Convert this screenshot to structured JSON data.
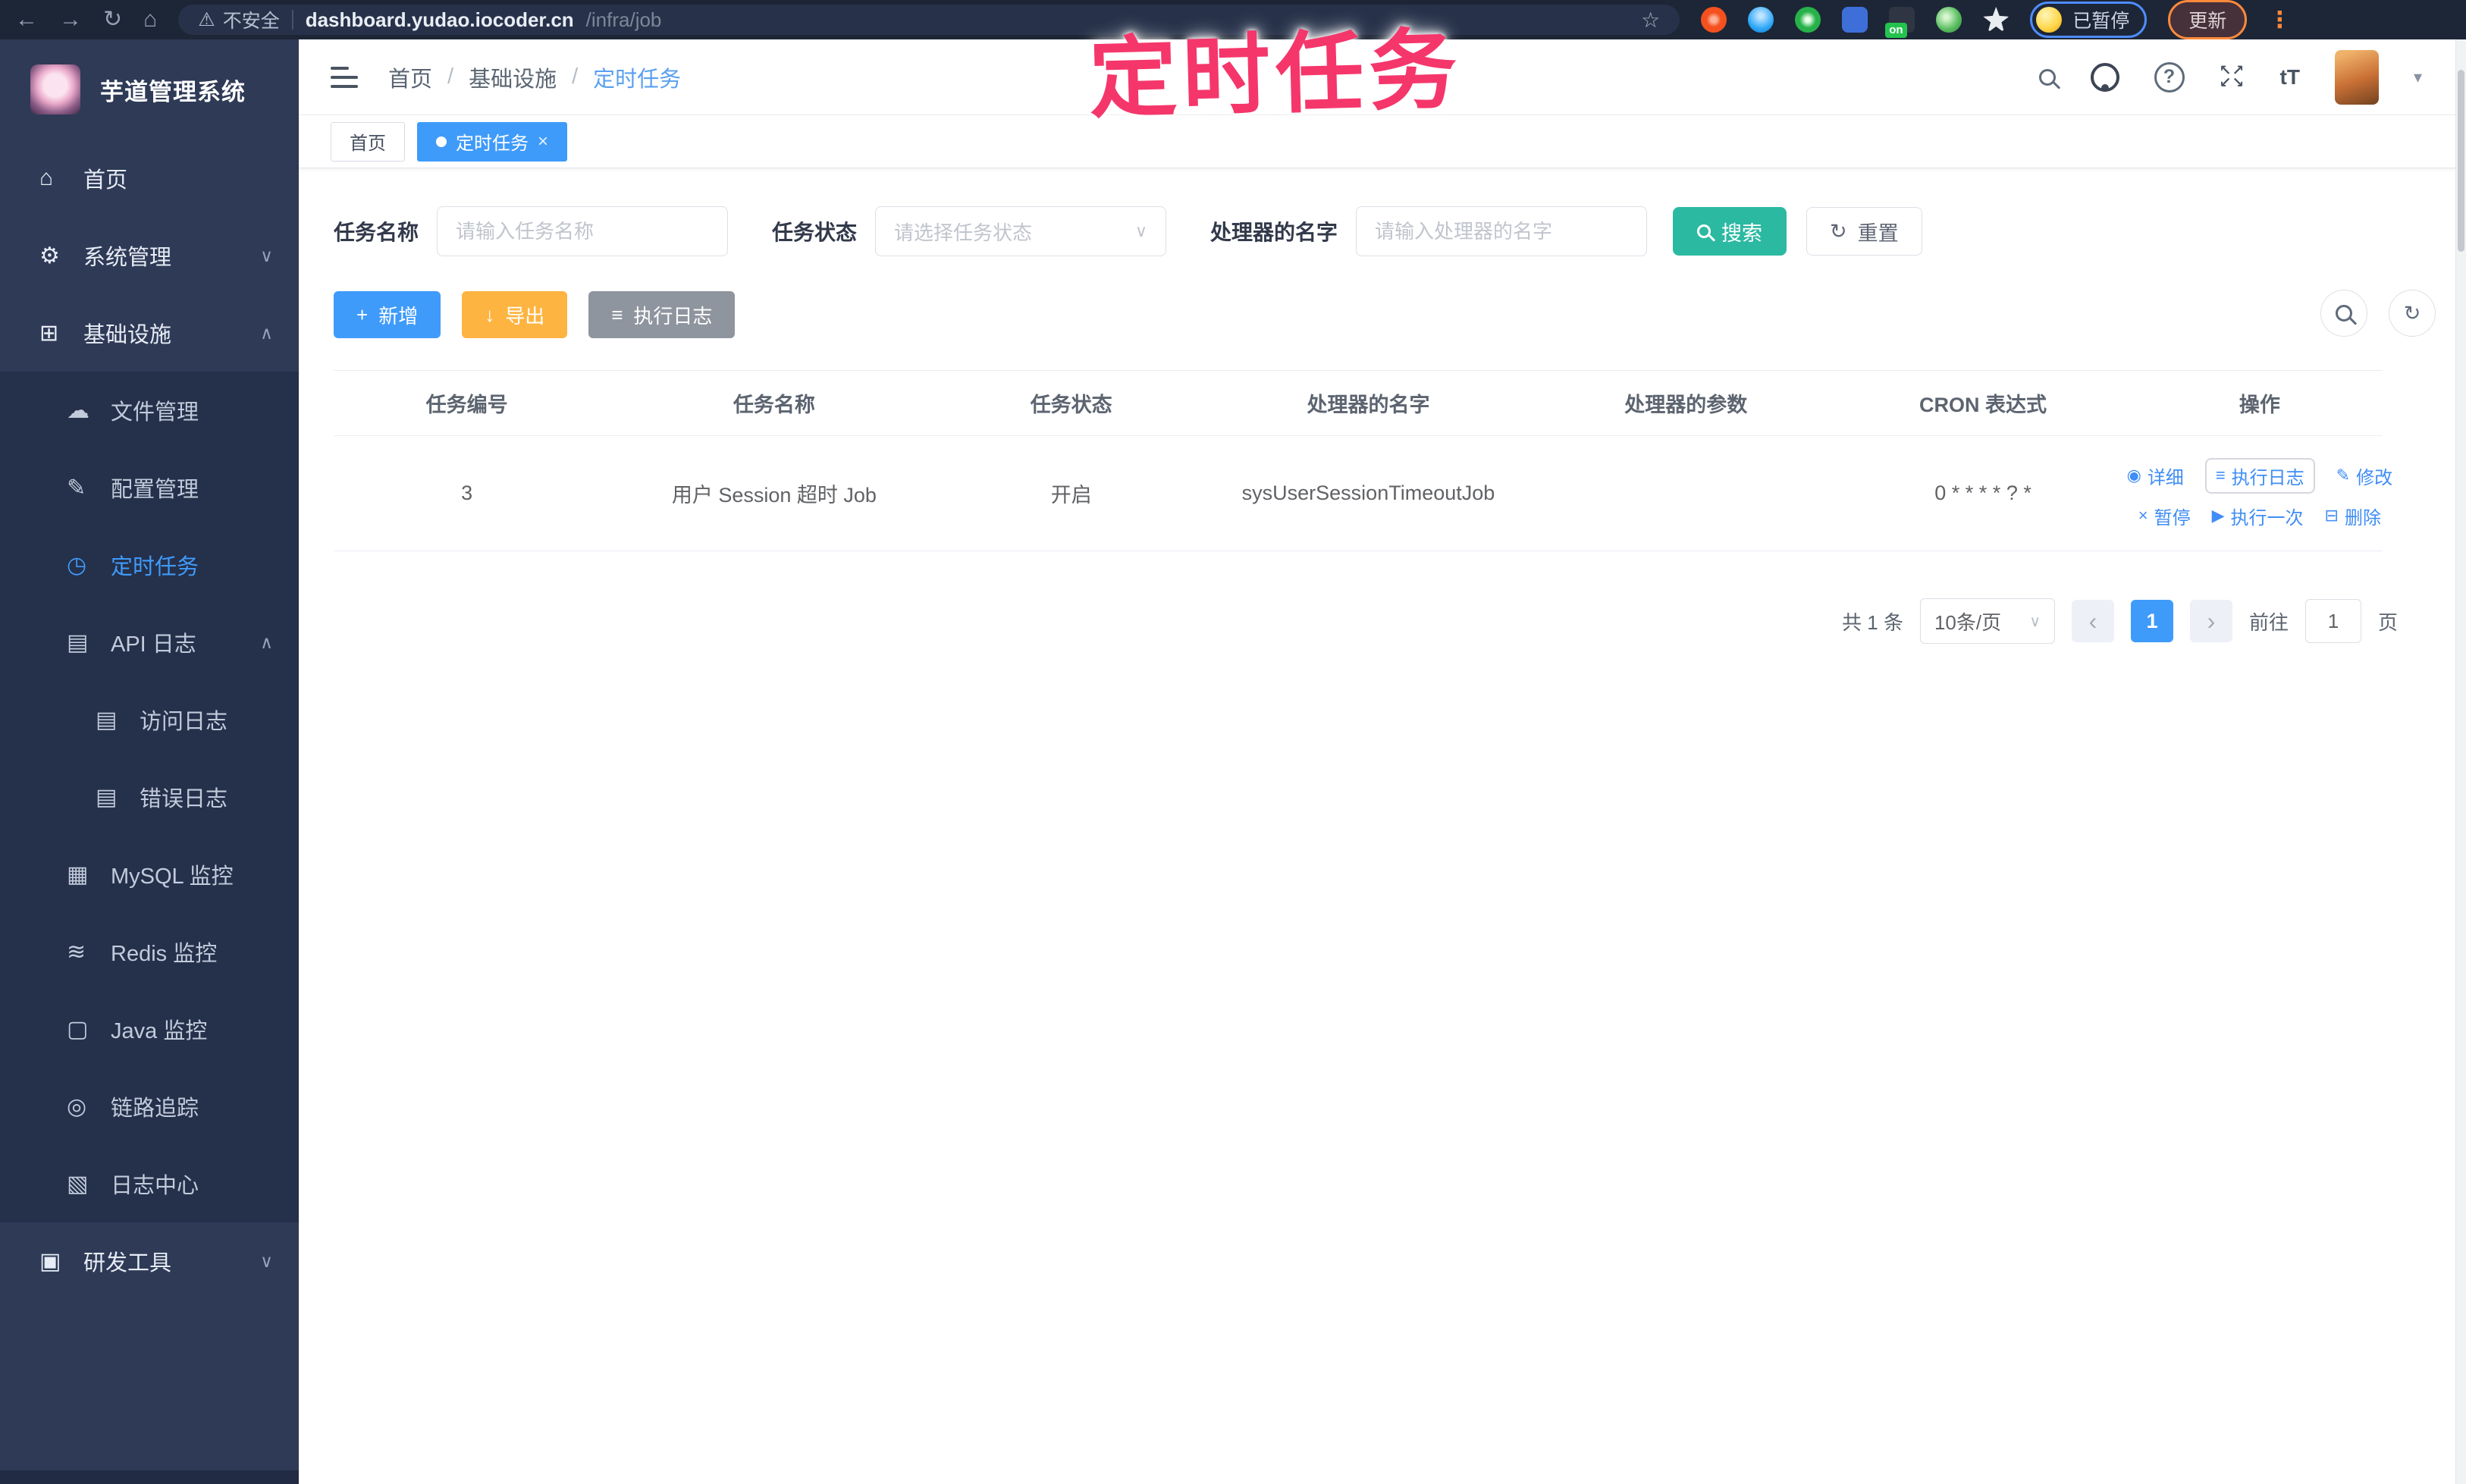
{
  "colors": {
    "accent": "#3f9bfa",
    "search_teal": "#2cb9a2",
    "export_orange": "#fdb441",
    "annotation_pink": "#f5366b"
  },
  "annotation": {
    "text": "定时任务"
  },
  "browser": {
    "security_label": "不安全",
    "host": "dashboard.yudao.iocoder.cn",
    "path": "/infra/job",
    "paused_label": "已暂停",
    "update_label": "更新",
    "on_badge": "on"
  },
  "glyphs": {
    "back": "←",
    "forward": "→",
    "reload": "↻",
    "home": "⌂",
    "warning": "⚠",
    "star": "☆",
    "menu_dots": "⋮",
    "help": "?",
    "caret_down": "▾",
    "text_size": "tT",
    "fs_tl": "↖",
    "fs_tr": "↗",
    "fs_bl": "↙",
    "fs_br": "↘",
    "tag_close": "×",
    "breadcrumb_sep": "/",
    "prev": "‹",
    "next": "›",
    "select_caret": "∨"
  },
  "sidebar": {
    "logo_title": "芋道管理系统",
    "items": [
      {
        "label": "首页",
        "glyph": "⌂",
        "chevron": ""
      },
      {
        "label": "系统管理",
        "glyph": "⚙",
        "chevron": "∨"
      },
      {
        "label": "基础设施",
        "glyph": "⊞",
        "chevron": "∧"
      },
      {
        "label": "文件管理",
        "glyph": "☁",
        "chevron": ""
      },
      {
        "label": "配置管理",
        "glyph": "✎",
        "chevron": ""
      },
      {
        "label": "定时任务",
        "glyph": "◷",
        "chevron": ""
      },
      {
        "label": "API 日志",
        "glyph": "▤",
        "chevron": "∧"
      },
      {
        "label": "访问日志",
        "glyph": "▤",
        "chevron": ""
      },
      {
        "label": "错误日志",
        "glyph": "▤",
        "chevron": ""
      },
      {
        "label": "MySQL 监控",
        "glyph": "▦",
        "chevron": ""
      },
      {
        "label": "Redis 监控",
        "glyph": "≋",
        "chevron": ""
      },
      {
        "label": "Java 监控",
        "glyph": "▢",
        "chevron": ""
      },
      {
        "label": "链路追踪",
        "glyph": "◎",
        "chevron": ""
      },
      {
        "label": "日志中心",
        "glyph": "▧",
        "chevron": ""
      },
      {
        "label": "研发工具",
        "glyph": "▣",
        "chevron": "∨"
      }
    ]
  },
  "header": {
    "breadcrumb": [
      "首页",
      "基础设施",
      "定时任务"
    ]
  },
  "tags": [
    {
      "label": "首页"
    },
    {
      "label": "定时任务"
    }
  ],
  "filters": {
    "name_label": "任务名称",
    "name_placeholder": "请输入任务名称",
    "status_label": "任务状态",
    "status_placeholder": "请选择任务状态",
    "handler_label": "处理器的名字",
    "handler_placeholder": "请输入处理器的名字",
    "search_label": "搜索",
    "reset_label": "重置",
    "reset_glyph": "↻"
  },
  "toolbar": {
    "add_glyph": "+",
    "add_label": "新增",
    "export_glyph": "↓",
    "export_label": "导出",
    "log_glyph": "≡",
    "log_label": "执行日志"
  },
  "table": {
    "headers": [
      "任务编号",
      "任务名称",
      "任务状态",
      "处理器的名字",
      "处理器的参数",
      "CRON 表达式",
      "操作"
    ],
    "row": {
      "id": "3",
      "name": "用户 Session 超时 Job",
      "status": "开启",
      "handler": "sysUserSessionTimeoutJob",
      "param": "",
      "cron": "0 * * * * ? *"
    },
    "actions": [
      {
        "glyph": "◉",
        "label": "详细"
      },
      {
        "glyph": "≡",
        "label": "执行日志"
      },
      {
        "glyph": "✎",
        "label": "修改"
      },
      {
        "glyph": "×",
        "label": "暂停"
      },
      {
        "glyph": "▶",
        "label": "执行一次"
      },
      {
        "glyph": "⊟",
        "label": "删除"
      }
    ]
  },
  "pagination": {
    "total": "共 1 条",
    "size": "10条/页",
    "page": "1",
    "goto_label": "前往",
    "goto_value": "1",
    "unit": "页"
  }
}
